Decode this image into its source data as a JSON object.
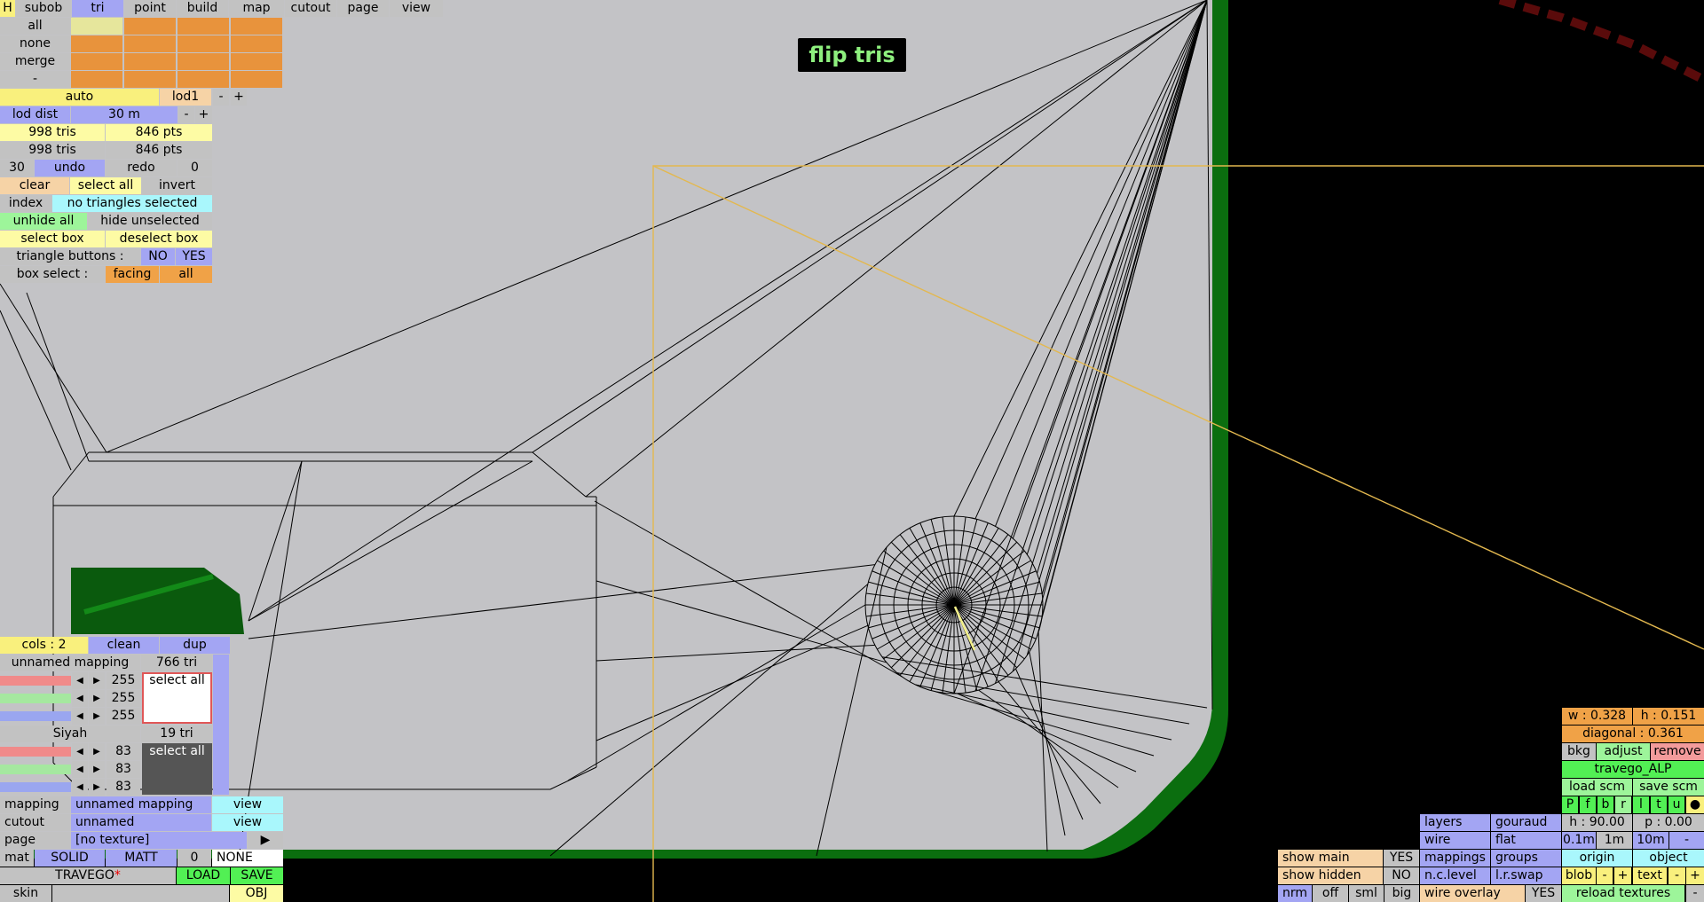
{
  "banner": "flip tris",
  "menubar": {
    "h": "H",
    "items": [
      "subob",
      "tri",
      "point",
      "build",
      "map",
      "cutout",
      "page",
      "view"
    ]
  },
  "select_rows": [
    "all",
    "none",
    "merge",
    "-"
  ],
  "lod": {
    "auto": "auto",
    "level": "lod1",
    "minus": "-",
    "plus": "+",
    "dist_label": "lod dist",
    "dist_value": "30 m"
  },
  "stats": {
    "tris1": "998 tris",
    "pts1": "846 pts",
    "tris2": "998 tris",
    "pts2": "846 pts"
  },
  "undo": {
    "count": "30",
    "undo": "undo",
    "redo": "redo",
    "redo_count": "0"
  },
  "selection": {
    "clear": "clear",
    "select_all": "select all",
    "invert": "invert",
    "index": "index",
    "status": "no triangles selected",
    "unhide_all": "unhide all",
    "hide_unselected": "hide unselected",
    "select_box": "select box",
    "deselect_box": "deselect box"
  },
  "triangle_buttons": {
    "label": "triangle buttons :",
    "no": "NO",
    "yes": "YES"
  },
  "box_select": {
    "label": "box select :",
    "facing": "facing",
    "all": "all"
  },
  "material": {
    "cols": "cols : 2",
    "clean": "clean",
    "dup": "dup",
    "mapping_name": "unnamed mapping",
    "mapping_tris": "766 tri",
    "rgb1": [
      "255",
      "255",
      "255"
    ],
    "select_all_1": "select all",
    "mat2_name": "Siyah",
    "mat2_tris": "19 tri",
    "rgb2": [
      "83",
      "83",
      "83"
    ],
    "select_all_2": "select all"
  },
  "bottom_left": {
    "mapping_label": "mapping",
    "mapping_value": "unnamed mapping",
    "mapping_view": "view",
    "cutout_label": "cutout",
    "cutout_value": "unnamed",
    "cutout_view": "view",
    "page_label": "page",
    "page_value": "[no texture]",
    "page_arrow": "▶",
    "mat_label": "mat",
    "solid": "SOLID",
    "matt": "MATT",
    "mat_num": "0",
    "none": "NONE",
    "object_name": "TRAVEGO",
    "dirty": "*",
    "load": "LOAD",
    "save": "SAVE",
    "skin": "skin",
    "obj": "OBJ"
  },
  "right_panel": {
    "w": "w : 0.328",
    "h": "h : 0.151",
    "diagonal": "diagonal : 0.361",
    "bkg": "bkg",
    "adjust": "adjust",
    "remove": "remove",
    "scene": "travego_ALP",
    "load_scm": "load scm",
    "save_scm": "save scm",
    "views": [
      "P",
      "f",
      "b",
      "r",
      "l",
      "t",
      "u",
      "●"
    ],
    "heading": "h : 90.00",
    "pitch": "p : 0.00",
    "grid": [
      "0.1m",
      "1m",
      "10m",
      "-"
    ],
    "layers": "layers",
    "gouraud": "gouraud",
    "wire": "wire",
    "flat": "flat",
    "mappings": "mappings",
    "groups": "groups",
    "origin": "origin",
    "object": "object",
    "nc_level": "n.c.level",
    "lr_swap": "l.r.swap",
    "blob": "blob",
    "blob_minus": "-",
    "blob_plus": "+",
    "text": "text",
    "text_minus": "-",
    "text_plus": "+",
    "show_main": "show main",
    "show_main_val": "YES",
    "show_hidden": "show hidden",
    "show_hidden_val": "NO",
    "nrm": "nrm",
    "off": "off",
    "sml": "sml",
    "big": "big",
    "wire_overlay": "wire overlay",
    "wire_overlay_val": "YES",
    "reload_textures": "reload textures",
    "rt_minus": "-"
  },
  "colors": {
    "background": "#000000",
    "surface": "#c3c3c6",
    "rim": "#0b6e0f",
    "guide": "#e3b84f",
    "banner_text": "#8ef07e"
  }
}
